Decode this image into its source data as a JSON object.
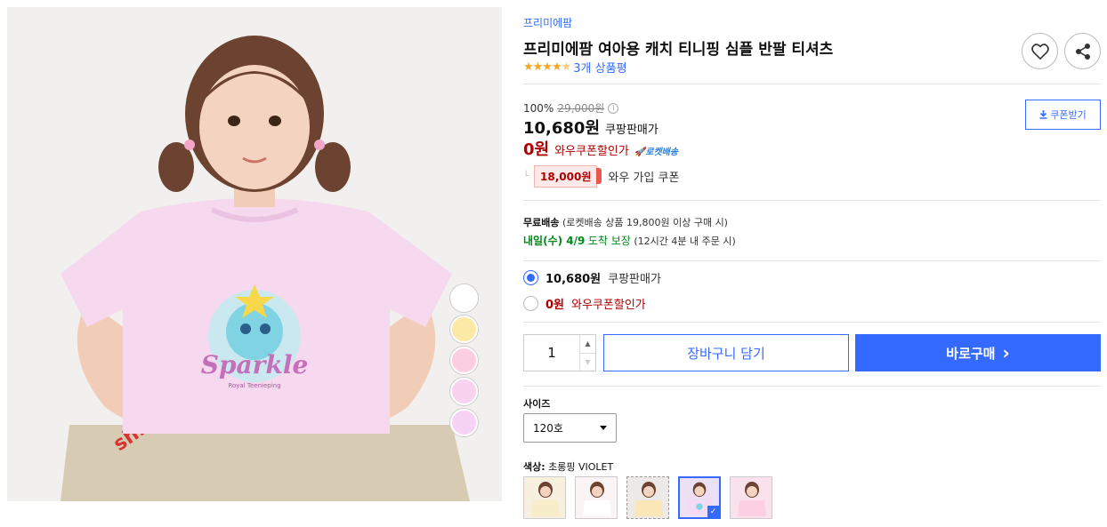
{
  "product": {
    "brand": "프리미에팜",
    "title": "프리미에팜 여아용 캐치 티니핑 심플 반팔 티셔츠",
    "rating_value": 4.5,
    "stars": "★★★★",
    "half_star": "★",
    "review_count": "3개 상품평"
  },
  "hero": {
    "image_alt": "child wearing pink Sparkle t-shirt",
    "print_text": "Sparkle",
    "print_subtext": "Royal Teenieping"
  },
  "color_swatches": [
    "#ffffff",
    "#fde9a6",
    "#fccfe0",
    "#f8d2ef",
    "#f6d3f4"
  ],
  "price": {
    "discount_rate": "100%",
    "original_price": "29,000원",
    "info_symbol": "i",
    "sale_price": "10,680원",
    "sale_label": "쿠팡판매가",
    "wow_price": "0원",
    "wow_label": "와우쿠폰할인가",
    "rocket_badge": "🚀로켓배송",
    "coupon_branch": "└",
    "coupon_amount": "18,000원",
    "coupon_text": "와우 가입 쿠폰",
    "coupon_button": "쿠폰받기"
  },
  "shipping": {
    "free_label": "무료배송",
    "free_detail": "(로켓배송 상품 19,800원 이상 구매 시)",
    "date": "내일(수) 4/9",
    "arrival": "도착 보장",
    "condition": "(12시간 4분 내 주문 시)"
  },
  "options": [
    {
      "price": "10,680원",
      "label": "쿠팡판매가",
      "selected": true
    },
    {
      "price": "0원",
      "label": "와우쿠폰할인가",
      "selected": false
    }
  ],
  "purchase": {
    "quantity": "1",
    "qty_up": "▲",
    "qty_down": "▼",
    "cart_button": "장바구니 담기",
    "buy_button": "바로구매",
    "buy_arrow": "›"
  },
  "size": {
    "label": "사이즈",
    "selected": "120호"
  },
  "color": {
    "label": "색상:",
    "selected": "초롱핑 VIOLET",
    "thumbs": [
      "#f7f0df",
      "#fbf4f5",
      "#ece9e7",
      "#ece0f5",
      "#f9e2ec"
    ],
    "selected_index": 3,
    "check": "✓"
  },
  "colors": {
    "accent": "#346aff",
    "wow_red": "#ae0000",
    "green": "#00891a",
    "star": "#f5a623"
  }
}
